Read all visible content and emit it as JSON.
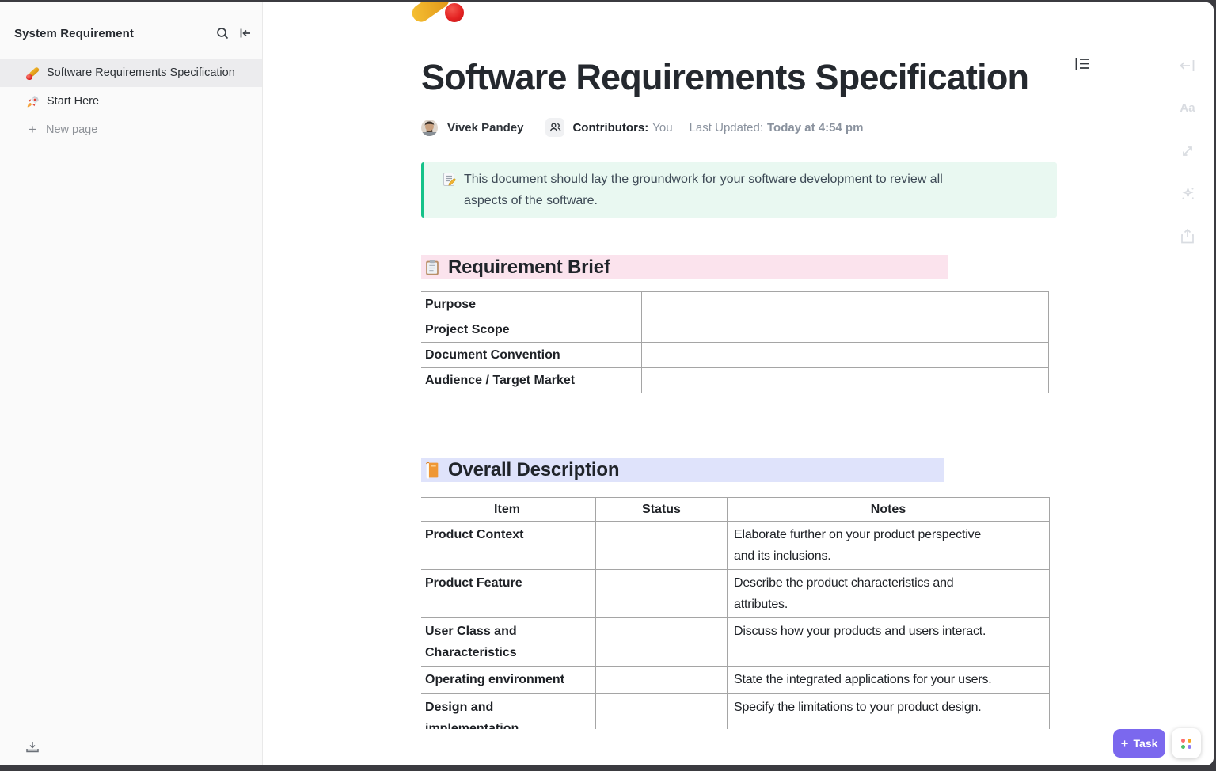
{
  "sidebar": {
    "title": "System Requirement",
    "items": [
      {
        "label": "Software Requirements Specification",
        "icon": "cricket-bat-and-ball-emoji",
        "selected": true
      },
      {
        "label": "Start Here",
        "icon": "rocket-emoji",
        "selected": false
      }
    ],
    "new_page_label": "New page"
  },
  "doc": {
    "page_emoji": "cricket-bat-and-ball-emoji",
    "title": "Software Requirements Specification",
    "author": "Vivek Pandey",
    "contributors_label": "Contributors:",
    "contributors_value": "You",
    "last_updated_label": "Last Updated:",
    "last_updated_value": "Today at 4:54 pm",
    "callout_text": "This document should lay the groundwork for your software development to review all\naspects of the software."
  },
  "brief": {
    "heading": "Requirement Brief",
    "icon": "clipboard-emoji",
    "rows": [
      "Purpose",
      "Project Scope",
      "Document Convention",
      "Audience / Target Market"
    ]
  },
  "overall": {
    "heading": "Overall Description",
    "icon": "orange-book-emoji",
    "columns": [
      "Item",
      "Status",
      "Notes"
    ],
    "rows": [
      {
        "item": "Product Context",
        "status": "",
        "notes": "Elaborate further on your product perspective\nand its inclusions."
      },
      {
        "item": "Product Feature",
        "status": "",
        "notes": "Describe the product characteristics and\nattributes."
      },
      {
        "item": "User Class and Characteristics",
        "status": "",
        "notes": "Discuss how your products and users interact."
      },
      {
        "item": "Operating environment",
        "status": "",
        "notes": "State the integrated applications for your users."
      },
      {
        "item": "Design and implementation",
        "status": "",
        "notes": "Specify the limitations to your product design."
      }
    ]
  },
  "footer": {
    "task_label": "Task"
  },
  "colors": {
    "accent_purple": "#7b68ee",
    "callout_green": "#15c289",
    "callout_bg": "#e9f8f1",
    "brief_highlight": "#fbe3ed",
    "overall_highlight": "#dfe3fb",
    "sidebar_bg": "#fafafa",
    "apps_dots": [
      "#fd6b6b",
      "#f5a623",
      "#4fc06c",
      "#8d7bf2"
    ]
  }
}
